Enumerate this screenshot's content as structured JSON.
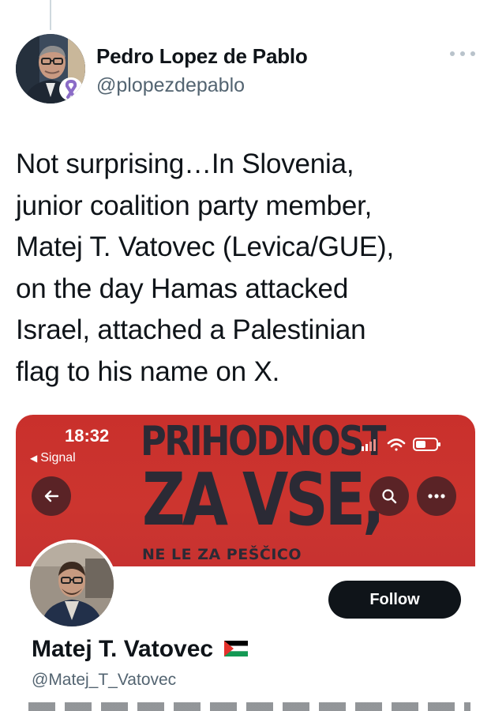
{
  "tweet": {
    "author_name": "Pedro Lopez de Pablo",
    "author_handle": "@plopezdepablo",
    "text": "Not surprising…In Slovenia,\njunior coalition party member,\nMatej T. Vatovec (Levica/GUE),\non the day Hamas attacked\nIsrael, attached a Palestinian\nflag to his name on X."
  },
  "embedded_screenshot": {
    "status_bar": {
      "time": "18:32",
      "back_app": "Signal"
    },
    "banner": {
      "line1": "PRIHODNOST",
      "line2": "ZA VSE,",
      "line3": "NE LE ZA PEŠČICO",
      "color": "#c9302c"
    },
    "profile": {
      "name": "Matej T. Vatovec",
      "handle": "@Matej_T_Vatovec",
      "follow_label": "Follow"
    }
  },
  "icons": [
    "more-icon",
    "ribbon-icon",
    "back-arrow-icon",
    "search-icon",
    "more-options-icon",
    "signal-bars-icon",
    "wifi-icon",
    "battery-icon",
    "palestine-flag-icon"
  ],
  "colors": {
    "text": "#0f1419",
    "secondary_text": "#536471",
    "follow_button": "#0f1419"
  }
}
